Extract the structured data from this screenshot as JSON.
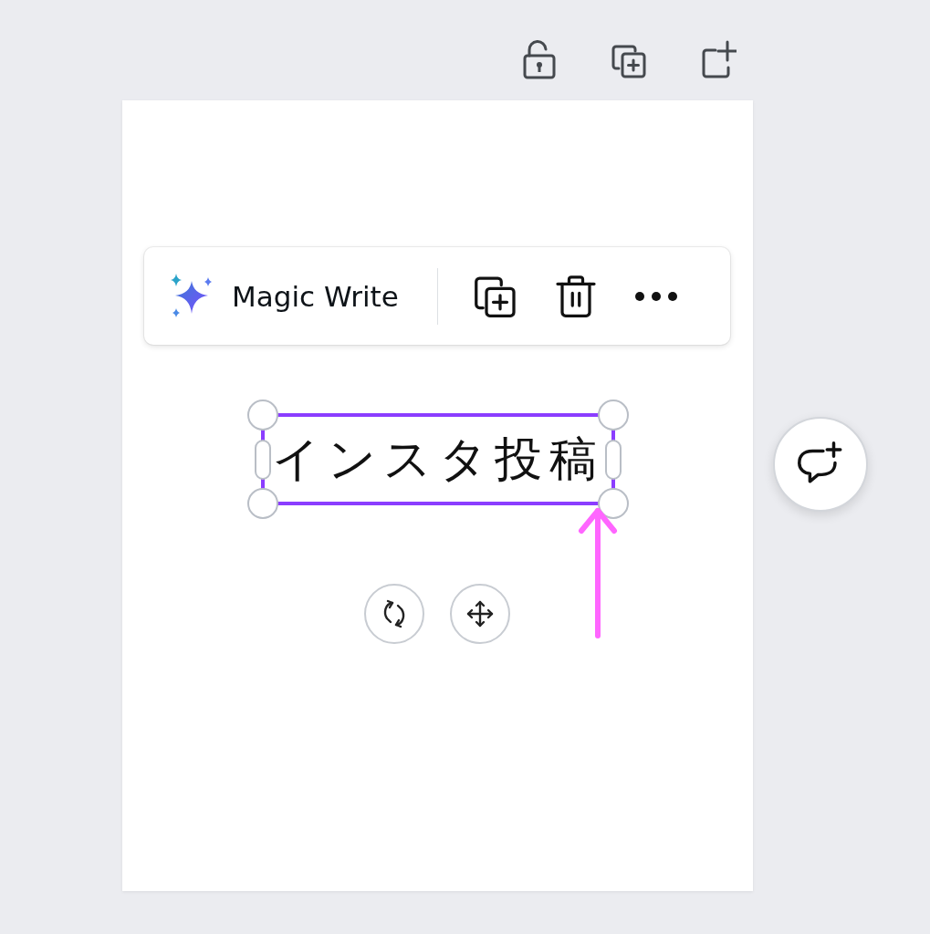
{
  "floating_toolbar": {
    "magic_write": {
      "label": "Magic Write"
    }
  },
  "text_box": {
    "text": "インスタ投稿",
    "selected": true
  }
}
